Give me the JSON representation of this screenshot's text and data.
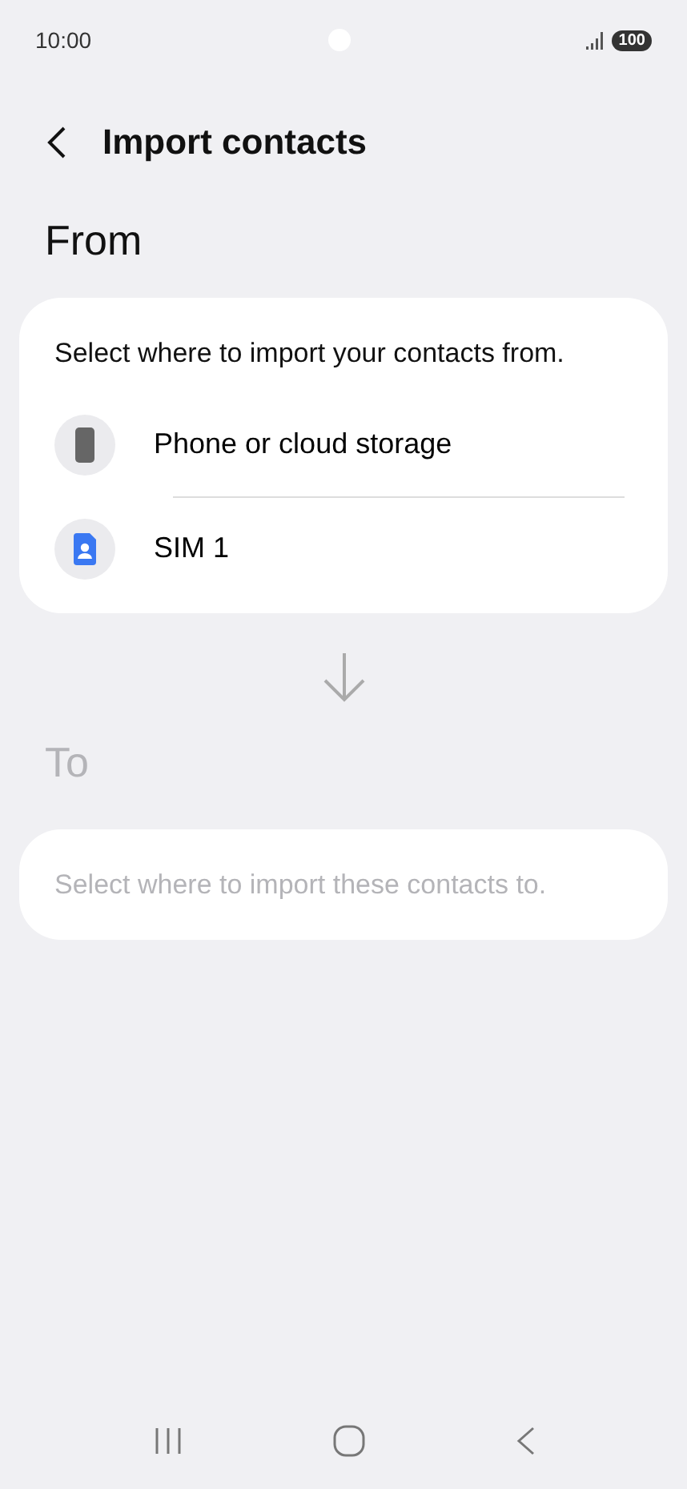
{
  "status_bar": {
    "time": "10:00",
    "battery": "100"
  },
  "header": {
    "title": "Import contacts"
  },
  "from": {
    "heading": "From",
    "hint": "Select where to import your contacts from.",
    "items": [
      {
        "kind": "phone",
        "label": "Phone or cloud storage"
      },
      {
        "kind": "sim",
        "label": "SIM 1"
      }
    ]
  },
  "to": {
    "heading": "To",
    "hint": "Select where to import these contacts to.",
    "disabled": true
  }
}
